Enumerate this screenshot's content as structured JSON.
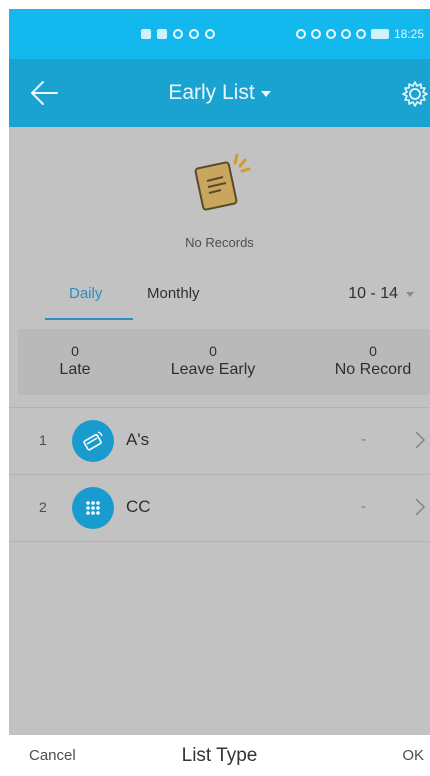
{
  "status_bar": {
    "time": "18:25",
    "battery": "86"
  },
  "header": {
    "title": "Early List",
    "back_icon": "back-arrow-icon",
    "settings_icon": "gear-icon"
  },
  "empty_state": {
    "icon": "document-icon",
    "text": "No Records"
  },
  "tabs": {
    "daily": "Daily",
    "monthly": "Monthly",
    "active": "daily",
    "date_range": "10 - 14"
  },
  "stats": {
    "late": {
      "value": "0",
      "label": "Late"
    },
    "leave_early": {
      "value": "0",
      "label": "Leave Early"
    },
    "no_record": {
      "value": "0",
      "label": "No Record"
    }
  },
  "list": [
    {
      "index": "1",
      "name": "A's",
      "value": "-",
      "icon": "card-swipe-icon"
    },
    {
      "index": "2",
      "name": "CC",
      "value": "-",
      "icon": "keypad-icon"
    }
  ],
  "bottom_bar": {
    "cancel": "Cancel",
    "title": "List Type",
    "ok": "OK"
  },
  "colors": {
    "status_bar": "#13b8ee",
    "header": "#1aa3d1",
    "overlay_bg": "#c2c2c2",
    "accent": "#2a8fc2",
    "avatar": "#1a9bd0"
  }
}
